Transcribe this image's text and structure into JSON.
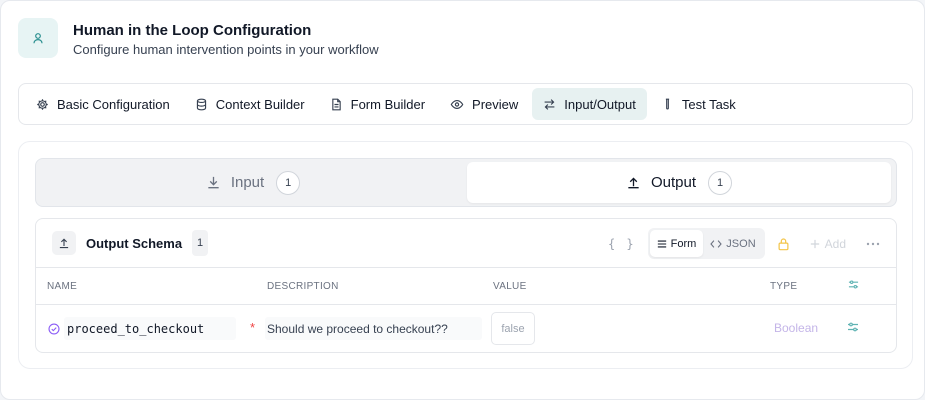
{
  "header": {
    "title": "Human in the Loop Configuration",
    "subtitle": "Configure human intervention points in your workflow",
    "icon": "user-icon"
  },
  "tabs": [
    {
      "label": "Basic Configuration",
      "icon": "gear-icon",
      "active": false
    },
    {
      "label": "Context Builder",
      "icon": "database-icon",
      "active": false
    },
    {
      "label": "Form Builder",
      "icon": "document-icon",
      "active": false
    },
    {
      "label": "Preview",
      "icon": "eye-icon",
      "active": false
    },
    {
      "label": "Input/Output",
      "icon": "swap-icon",
      "active": true
    },
    {
      "label": "Test Task",
      "icon": "test-tube-icon",
      "active": false
    }
  ],
  "io_toggle": {
    "input_label": "Input",
    "input_count": "1",
    "output_label": "Output",
    "output_count": "1",
    "selected": "Output"
  },
  "schema": {
    "title": "Output Schema",
    "count": "1",
    "braces": "{ }",
    "form_label": "Form",
    "json_label": "JSON",
    "add_label": "Add",
    "columns": {
      "name": "NAME",
      "description": "DESCRIPTION",
      "value": "VALUE",
      "type": "TYPE"
    },
    "rows": [
      {
        "name": "proceed_to_checkout",
        "required_mark": "*",
        "description": "Should we proceed to checkout??",
        "value": "false",
        "type": "Boolean"
      }
    ]
  },
  "colors": {
    "accent": "#1f8a8a",
    "active_tab_bg": "#e7f1f1",
    "boolean_type": "#c4b5e8",
    "lock": "#f3c54a",
    "required": "#ef4444"
  }
}
